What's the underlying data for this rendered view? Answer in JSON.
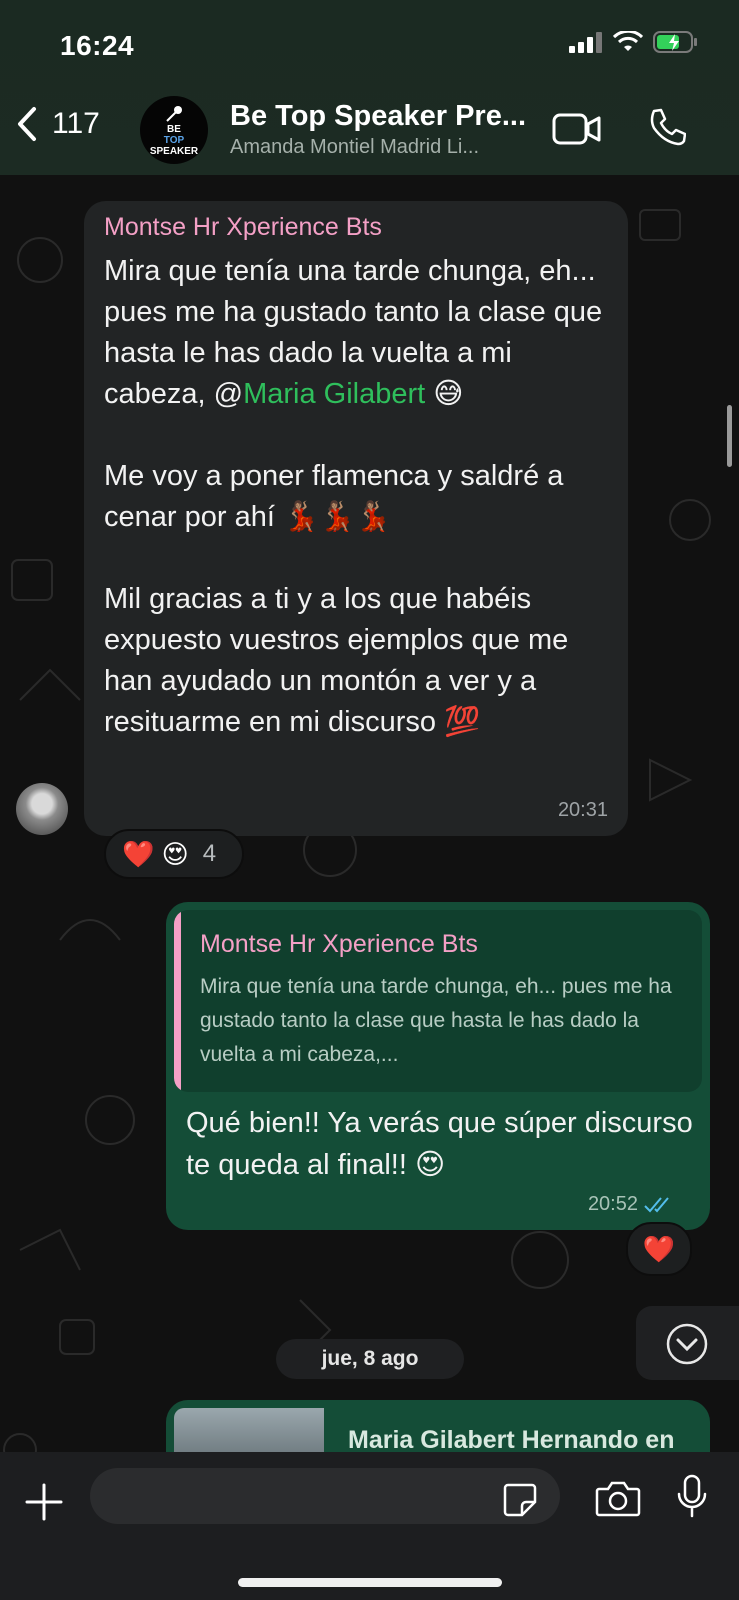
{
  "status_bar": {
    "time": "16:24"
  },
  "header": {
    "back_count": "117",
    "group_avatar_line1": "BE",
    "group_avatar_line2": "TOP",
    "group_avatar_line3": "SPEAKER",
    "title": "Be Top Speaker Pre...",
    "subtitle": "Amanda Montiel Madrid Li..."
  },
  "messages": {
    "incoming": {
      "sender": "Montse Hr Xperience  Bts",
      "text_before_mention": "Mira que tenía una tarde chunga, eh... pues me ha gustado tanto la clase que hasta le has dado la vuelta a mi cabeza, @",
      "mention": "Maria Gilabert",
      "text_after_mention": " 😅\n\nMe voy a poner flamenca y saldré a cenar por ahí 💃🏽💃🏽💃🏽\n\nMil gracias a ti y a los que habéis expuesto vuestros ejemplos que me han ayudado un montón a ver y a resituarme en mi discurso 💯",
      "time": "20:31",
      "reactions": {
        "emojis": "❤️ 😍",
        "count": "4"
      }
    },
    "outgoing": {
      "quote_sender": "Montse Hr Xperience  Bts",
      "quote_text": "Mira que tenía una tarde chunga, eh... pues me ha gustado tanto la clase que hasta le has dado la vuelta a mi cabeza,...",
      "text": "Qué bien!! Ya verás que súper discurso te queda al final!! 😍",
      "time": "20:52",
      "reaction": "❤️"
    },
    "date_separator": "jue, 8 ago",
    "link_preview": {
      "title": "Maria Gilabert Hernando en"
    }
  },
  "colors": {
    "header_bg": "#1b2a22",
    "incoming_bubble": "#222425",
    "outgoing_bubble": "#144d37",
    "sender_name": "#f4a0c6",
    "mention": "#2fbf5c",
    "read_ticks": "#53bdeb"
  },
  "icons": [
    "back-chevron-icon",
    "video-call-icon",
    "voice-call-icon",
    "plus-icon",
    "sticker-icon",
    "camera-icon",
    "microphone-icon",
    "scroll-down-icon",
    "read-ticks-icon",
    "signal-icon",
    "wifi-icon",
    "battery-icon"
  ]
}
